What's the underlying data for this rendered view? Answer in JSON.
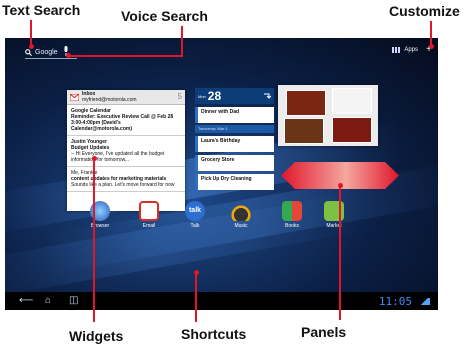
{
  "callouts": {
    "text_search": "Text Search",
    "voice_search": "Voice Search",
    "customize": "Customize",
    "widgets": "Widgets",
    "shortcuts": "Shortcuts",
    "panels": "Panels"
  },
  "screen": {
    "search_placeholder": "Google",
    "apps_label": "Apps",
    "plus_symbol": "+",
    "gmail": {
      "title": "Inbox",
      "account": "myfriend@motorola.com",
      "count": "5",
      "messages": [
        {
          "from": "Google Calendar",
          "subject": "Reminder: Executive Review Call @ Feb 28",
          "detail": "3:00-4:00pm (David's Calendar@motorola.com)"
        },
        {
          "from": "Justin Younger",
          "subject": "Budget Updates",
          "detail": "-- Hi Everyone, I've updated all the budget information for tomorrow..."
        },
        {
          "from": "Me, Frankie",
          "subject": "content updates for marketing materials",
          "detail": "Sounds like a plan. Let's move forward for now"
        }
      ]
    },
    "calendar": {
      "month": "Mon",
      "day": "28",
      "events": [
        "Dinner with Dad",
        "Laura's Birthday",
        "Grocery Store",
        "Pick Up Dry Cleaning"
      ],
      "tomorrow_label": "Tomorrow, Mar 1"
    },
    "shortcuts": [
      {
        "label": "Browser",
        "color": "#3a7bd5"
      },
      {
        "label": "Email",
        "color": "#d93025"
      },
      {
        "label": "Talk",
        "color": "#2c6fd1"
      },
      {
        "label": "Music",
        "color": "#f2a600"
      },
      {
        "label": "Books",
        "color": "#34a853"
      },
      {
        "label": "Market",
        "color": "#7cc143"
      }
    ],
    "clock": "11:05",
    "accent": "#e0162b"
  }
}
